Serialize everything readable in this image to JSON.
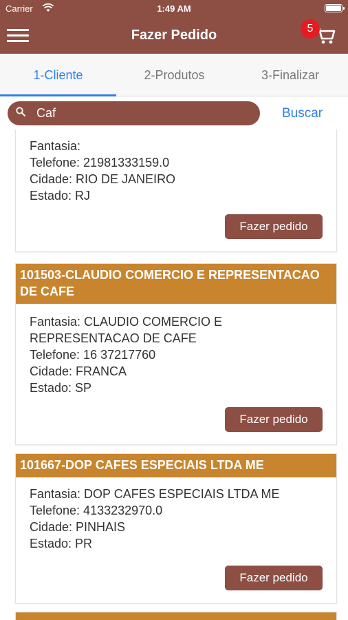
{
  "status_bar": {
    "carrier": "Carrier",
    "time": "1:49 AM"
  },
  "nav": {
    "title": "Fazer Pedido",
    "cart_count": "5"
  },
  "tabs": [
    {
      "label": "1-Cliente",
      "active": true
    },
    {
      "label": "2-Produtos",
      "active": false
    },
    {
      "label": "3-Finalizar",
      "active": false
    }
  ],
  "search": {
    "value": "Caf",
    "button_label": "Buscar"
  },
  "clients": [
    {
      "fantasia": "Fantasia:",
      "telefone": "Telefone: 21981333159.0",
      "cidade": "Cidade: RIO DE JANEIRO",
      "estado": "Estado: RJ",
      "button_label": "Fazer pedido"
    },
    {
      "header": "101503-CLAUDIO COMERCIO E REPRESENTACAO DE CAFE",
      "fantasia": "Fantasia: CLAUDIO COMERCIO E REPRESENTACAO DE CAFE",
      "telefone": "Telefone: 16 37217760",
      "cidade": "Cidade: FRANCA",
      "estado": "Estado: SP",
      "button_label": "Fazer pedido"
    },
    {
      "header": "101667-DOP CAFES ESPECIAIS LTDA ME",
      "fantasia": "Fantasia: DOP CAFES ESPECIAIS LTDA ME",
      "telefone": "Telefone: 4133232970.0",
      "cidade": "Cidade: PINHAIS",
      "estado": "Estado: PR",
      "button_label": "Fazer pedido"
    }
  ],
  "colors": {
    "brand": "#8d4e43",
    "card_header": "#c8852e",
    "accent": "#2f80e8",
    "badge": "#e51b22"
  }
}
